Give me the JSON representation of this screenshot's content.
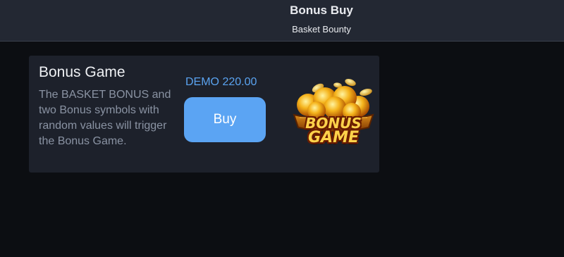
{
  "header": {
    "title": "Bonus Buy",
    "subtitle": "Basket Bounty"
  },
  "card": {
    "title": "Bonus Game",
    "description": "The BASKET BONUS and two Bonus symbols with random values will trigger the Bonus Game.",
    "price": "DEMO 220.00",
    "buy_label": "Buy",
    "icon": {
      "name": "bonus-game-basket-icon",
      "line1": "BONUS",
      "line2": "GAME"
    }
  },
  "colors": {
    "background": "#0c0e12",
    "header": "#232833",
    "card": "#1d212b",
    "accent": "#5ba4f3",
    "price": "#5aa3f0",
    "muted_text": "#8a93a3"
  }
}
